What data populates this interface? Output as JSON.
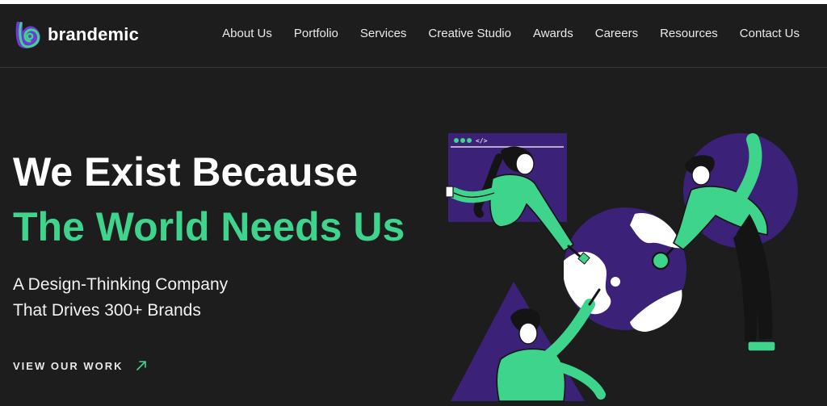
{
  "brand": {
    "name": "brandemic",
    "accent": "#3ed48c",
    "purple": "#3b2278",
    "background": "#1d1d1d"
  },
  "nav": {
    "items": [
      {
        "label": "About Us"
      },
      {
        "label": "Portfolio"
      },
      {
        "label": "Services"
      },
      {
        "label": "Creative Studio"
      },
      {
        "label": "Awards"
      },
      {
        "label": "Careers"
      },
      {
        "label": "Resources"
      },
      {
        "label": "Contact Us"
      }
    ]
  },
  "hero": {
    "title_line1": "We Exist Because",
    "title_line2": "The World Needs Us",
    "subtitle_line1": "A Design-Thinking Company",
    "subtitle_line2": "That Drives 300+ Brands",
    "cta_label": "VIEW OUR WORK",
    "cta_icon": "arrow-up-right-icon"
  },
  "illustration": {
    "browser_code_tag": "</>"
  }
}
